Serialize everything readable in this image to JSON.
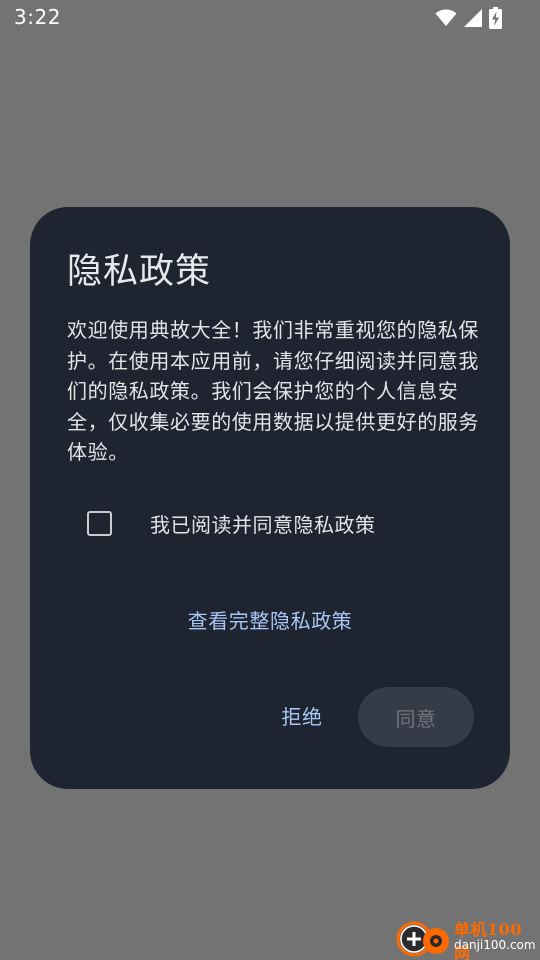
{
  "status_bar": {
    "time": "3:22",
    "icons": [
      "wifi-icon",
      "cellular-signal-icon",
      "battery-charging-icon"
    ]
  },
  "dialog": {
    "title": "隐私政策",
    "body": "欢迎使用典故大全！我们非常重视您的隐私保护。在使用本应用前，请您仔细阅读并同意我们的隐私政策。我们会保护您的个人信息安全，仅收集必要的使用数据以提供更好的服务体验。",
    "consent_checkbox": {
      "label": "我已阅读并同意隐私政策",
      "checked": false
    },
    "policy_link": "查看完整隐私政策",
    "reject_label": "拒绝",
    "agree_label": "同意",
    "agree_enabled": false
  },
  "watermark": {
    "name": "单机100网",
    "domain": "danji100.com"
  },
  "colors": {
    "scrim": "#737373",
    "dialog_bg": "#1f2530",
    "accent_text": "#a9c6f5",
    "disabled_button_bg": "#363c47",
    "disabled_button_text": "#6e737c",
    "watermark_orange": "#ff6a00"
  }
}
